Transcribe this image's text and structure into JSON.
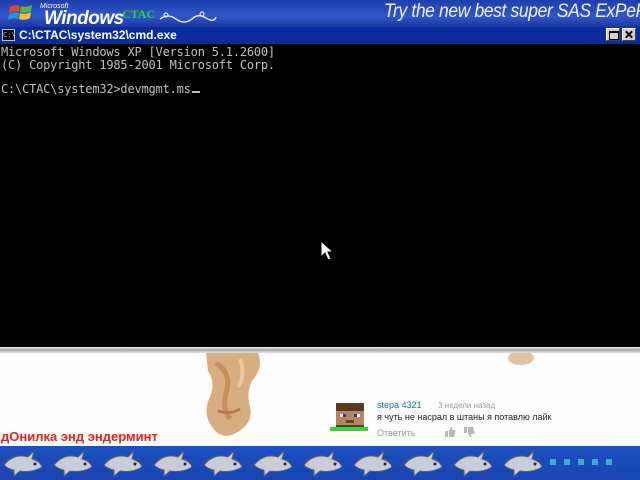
{
  "banner": {
    "microsoft_label": "Microsoft",
    "windows_label": "Windows",
    "ctac_label": "CTAC",
    "promo_text": "Try the new best super SAS ExPeRiEnCe"
  },
  "cmd_window": {
    "title": "C:\\CTAC\\system32\\cmd.exe",
    "icon_label": "C:\\",
    "lines": [
      "Microsoft Windows XP [Version 5.1.2600]",
      "(C) Copyright 1985-2001 Microsoft Corp."
    ],
    "prompt": "C:\\CTAC\\system32>",
    "typed_command": "devmgmt.ms"
  },
  "video": {
    "comment": {
      "username": "stepa 4321",
      "time_ago": "3 недели назад",
      "text": "я чуть не насрал в штаны я потавлю лайк",
      "reply_label": "Ответить"
    },
    "caption": "дОнилка энд эндерминт"
  },
  "colors": {
    "banner_blue": "#2f56c9",
    "titlebar_blue": "#0a2c9c",
    "console_bg": "#000000",
    "console_text": "#c0c0c0",
    "caption_red": "#e3231d",
    "username_blue": "#1a6fbd"
  },
  "icons": [
    "windows-flag-icon",
    "cmd-icon",
    "maximize-icon",
    "close-icon",
    "mouse-pointer-icon",
    "thumbs-up-icon",
    "thumbs-down-icon",
    "shark-icon"
  ]
}
